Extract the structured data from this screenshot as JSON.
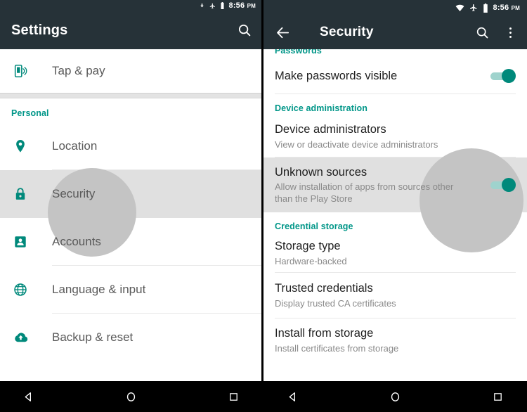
{
  "left": {
    "statusbar": {
      "time": "8:56",
      "ampm": "PM",
      "icons": [
        "download-icon",
        "airplane-icon",
        "battery-icon"
      ]
    },
    "toolbar": {
      "title": "Settings",
      "search_icon": "search-icon"
    },
    "items": [
      {
        "label": "Tap & pay",
        "icon": "nfc-tap-and-pay-icon",
        "selected": false
      },
      {
        "label": "Location",
        "icon": "location-pin-icon",
        "selected": false
      },
      {
        "label": "Security",
        "icon": "lock-icon",
        "selected": true
      },
      {
        "label": "Accounts",
        "icon": "account-badge-icon",
        "selected": false
      },
      {
        "label": "Language & input",
        "icon": "globe-icon",
        "selected": false
      },
      {
        "label": "Backup & reset",
        "icon": "cloud-upload-icon",
        "selected": false
      }
    ],
    "section_header": "Personal",
    "navbar": {
      "back": "back-triangle-icon",
      "home": "home-circle-icon",
      "recents": "recents-square-icon"
    }
  },
  "right": {
    "statusbar": {
      "time": "8:56",
      "ampm": "PM",
      "icons": [
        "wifi-icon",
        "airplane-icon",
        "battery-icon"
      ]
    },
    "toolbar": {
      "title": "Security",
      "back_icon": "arrow-back-icon",
      "search_icon": "search-icon",
      "more_icon": "overflow-menu-icon"
    },
    "sections": [
      {
        "header": "Passwords"
      },
      {
        "header": "Device administration"
      },
      {
        "header": "Credential storage"
      }
    ],
    "rows": [
      {
        "title": "Make passwords visible",
        "sub": "",
        "toggle": "on",
        "selected": false
      },
      {
        "title": "Device administrators",
        "sub": "View or deactivate device administrators",
        "toggle": "none",
        "selected": false
      },
      {
        "title": "Unknown sources",
        "sub": "Allow installation of apps from sources other than the Play Store",
        "toggle": "on",
        "selected": true
      },
      {
        "title": "Storage type",
        "sub": "Hardware-backed",
        "toggle": "none",
        "selected": false
      },
      {
        "title": "Trusted credentials",
        "sub": "Display trusted CA certificates",
        "toggle": "none",
        "selected": false
      },
      {
        "title": "Install from storage",
        "sub": "Install certificates from storage",
        "toggle": "none",
        "selected": false
      }
    ],
    "navbar": {
      "back": "back-triangle-icon",
      "home": "home-circle-icon",
      "recents": "recents-square-icon"
    }
  },
  "colors": {
    "toolbar": "#263238",
    "accent_teal": "#009688",
    "toggle_on": "#00897b",
    "selected_row": "#e0e0e0",
    "ripple": "#c4c4c4"
  }
}
